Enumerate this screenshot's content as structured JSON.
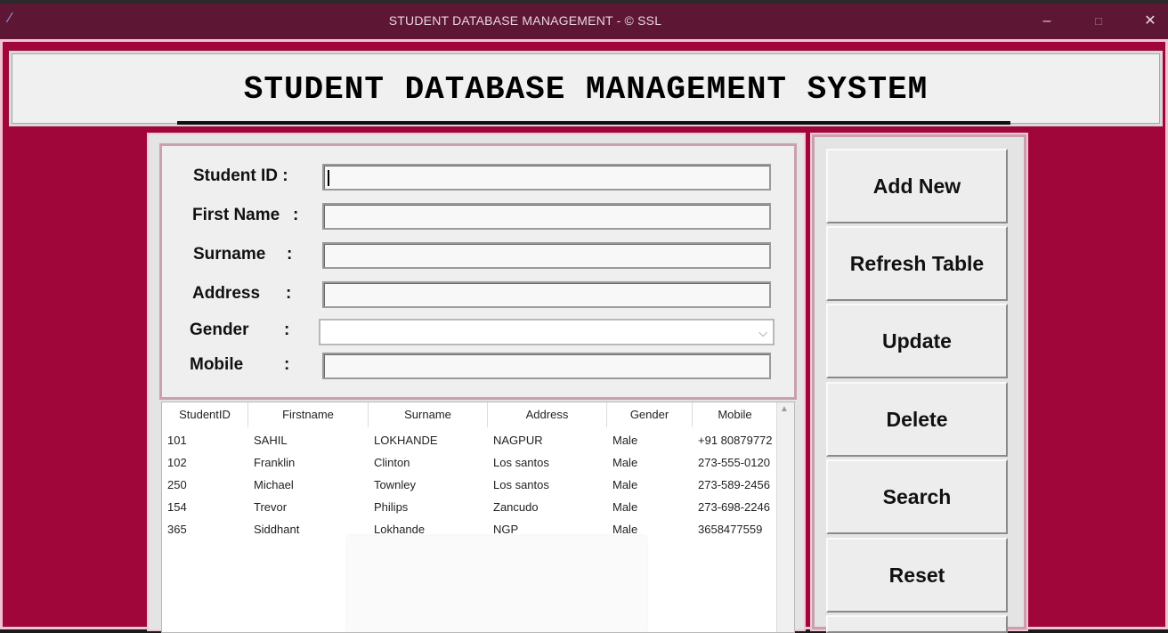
{
  "window": {
    "title": "STUDENT DATABASE MANAGEMENT - © SSL",
    "app_icon": "feather-icon",
    "controls": {
      "minimize": "–",
      "maximize": "□",
      "close": "✕"
    }
  },
  "header": {
    "title": "STUDENT DATABASE MANAGEMENT SYSTEM"
  },
  "form": {
    "student_id": {
      "label": "Student ID :",
      "value": ""
    },
    "first_name": {
      "label": "First Name",
      "value": ""
    },
    "surname": {
      "label": "Surname",
      "value": ""
    },
    "address": {
      "label": "Address",
      "value": ""
    },
    "gender": {
      "label": "Gender",
      "value": ""
    },
    "mobile": {
      "label": "Mobile",
      "value": ""
    },
    "colon": ":"
  },
  "table": {
    "columns": [
      "StudentID",
      "Firstname",
      "Surname",
      "Address",
      "Gender",
      "Mobile"
    ],
    "rows": [
      [
        "101",
        "SAHIL",
        "LOKHANDE",
        "NAGPUR",
        "Male",
        "+91 80879772"
      ],
      [
        "102",
        "Franklin",
        "Clinton",
        "Los santos",
        "Male",
        "273-555-0120"
      ],
      [
        "250",
        "Michael",
        "Townley",
        "Los santos",
        "Male",
        "273-589-2456"
      ],
      [
        "154",
        "Trevor",
        "Philips",
        "Zancudo",
        "Male",
        "273-698-2246"
      ],
      [
        "365",
        "Siddhant",
        "Lokhande",
        "NGP",
        "Male",
        "3658477559"
      ]
    ]
  },
  "buttons": {
    "add_new": "Add New",
    "refresh": "Refresh Table",
    "update": "Update",
    "delete": "Delete",
    "search": "Search",
    "reset": "Reset"
  },
  "colors": {
    "titlebar": "#5e1635",
    "background": "#a0063a",
    "panel": "#e4e4e4"
  }
}
